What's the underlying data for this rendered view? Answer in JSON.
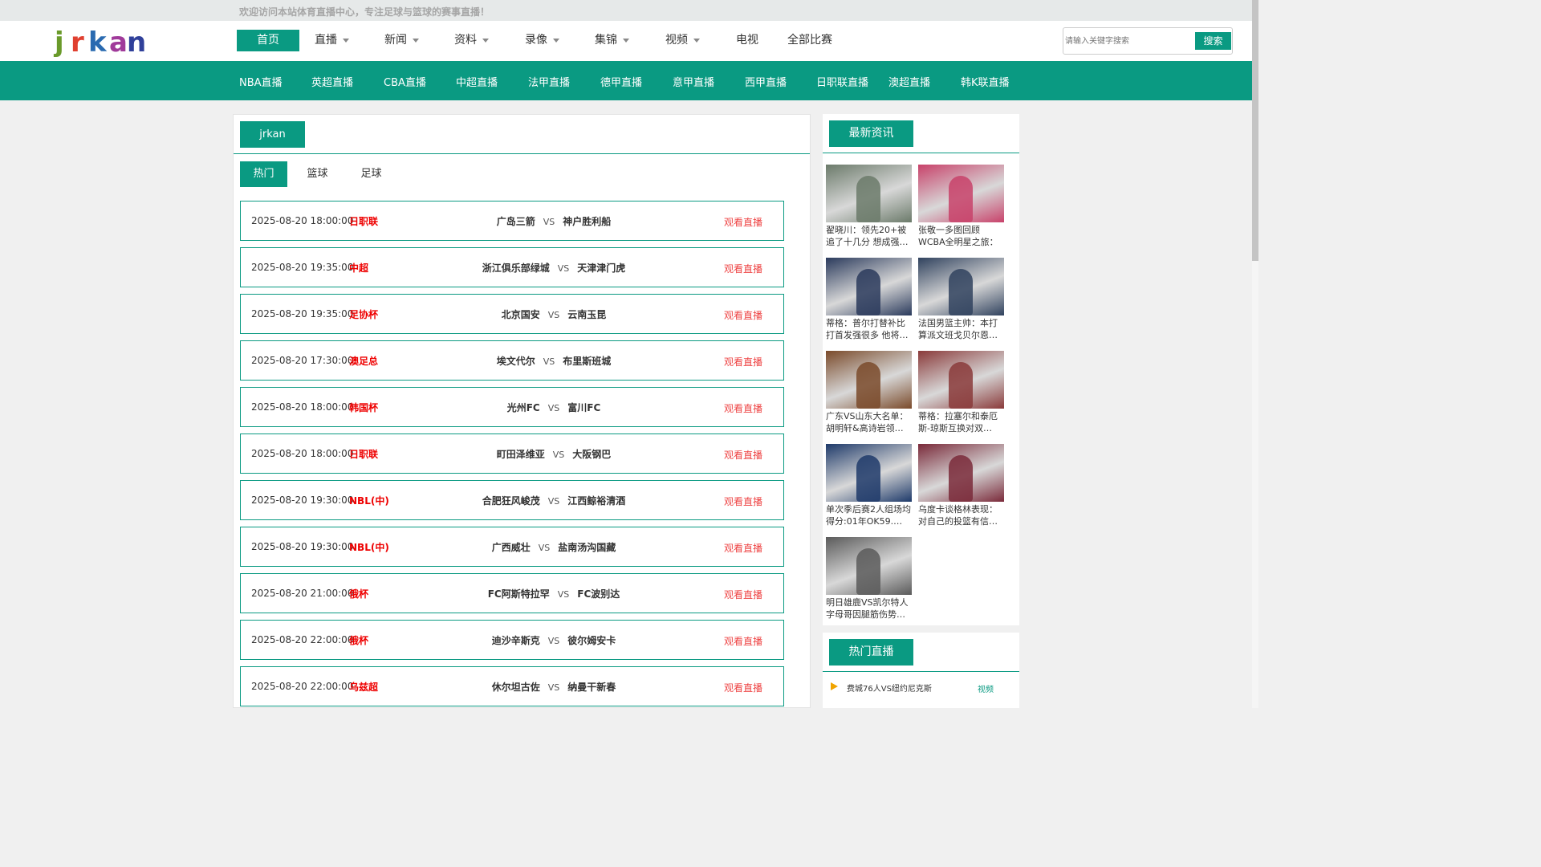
{
  "topbar": {
    "message": "欢迎访问本站体育直播中心，专注足球与篮球的赛事直播！"
  },
  "logo": {
    "text": "jrkan"
  },
  "nav": {
    "items": [
      {
        "label": "首页",
        "active": true,
        "dropdown": false
      },
      {
        "label": "直播",
        "active": false,
        "dropdown": true
      },
      {
        "label": "新闻",
        "active": false,
        "dropdown": true
      },
      {
        "label": "资料",
        "active": false,
        "dropdown": true
      },
      {
        "label": "录像",
        "active": false,
        "dropdown": true
      },
      {
        "label": "集锦",
        "active": false,
        "dropdown": true
      },
      {
        "label": "视频",
        "active": false,
        "dropdown": true
      },
      {
        "label": "电视",
        "active": false,
        "dropdown": false
      },
      {
        "label": "全部比赛",
        "active": false,
        "dropdown": false
      }
    ]
  },
  "search": {
    "placeholder": "请输入关键字搜索",
    "button": "搜索"
  },
  "subnav": {
    "items": [
      "NBA直播",
      "英超直播",
      "CBA直播",
      "中超直播",
      "法甲直播",
      "德甲直播",
      "意甲直播",
      "西甲直播",
      "日职联直播",
      "澳超直播",
      "韩K联直播"
    ]
  },
  "main": {
    "title": "jrkan",
    "tabs": [
      {
        "label": "热门",
        "active": true
      },
      {
        "label": "篮球",
        "active": false
      },
      {
        "label": "足球",
        "active": false
      }
    ],
    "watch_label": "观看直播",
    "vs_label": "VS",
    "matches": [
      {
        "time": "2025-08-20 18:00:00",
        "league": "日职联",
        "home": "广岛三箭",
        "away": "神户胜利船"
      },
      {
        "time": "2025-08-20 19:35:00",
        "league": "中超",
        "home": "浙江俱乐部绿城",
        "away": "天津津门虎"
      },
      {
        "time": "2025-08-20 19:35:00",
        "league": "足协杯",
        "home": "北京国安",
        "away": "云南玉昆"
      },
      {
        "time": "2025-08-20 17:30:00",
        "league": "澳足总",
        "home": "埃文代尔",
        "away": "布里斯班城"
      },
      {
        "time": "2025-08-20 18:00:00",
        "league": "韩国杯",
        "home": "光州FC",
        "away": "富川FC"
      },
      {
        "time": "2025-08-20 18:00:00",
        "league": "日职联",
        "home": "町田泽维亚",
        "away": "大阪钢巴"
      },
      {
        "time": "2025-08-20 19:30:00",
        "league": "NBL(中)",
        "home": "合肥狂风峻茂",
        "away": "江西鲸裕清酒"
      },
      {
        "time": "2025-08-20 19:30:00",
        "league": "NBL(中)",
        "home": "广西威壮",
        "away": "盐南汤沟国藏"
      },
      {
        "time": "2025-08-20 21:00:00",
        "league": "俄杯",
        "home": "FC阿斯特拉罕",
        "away": "FC波别达"
      },
      {
        "time": "2025-08-20 22:00:00",
        "league": "俄杯",
        "home": "迪沙辛斯克",
        "away": "彼尔姆安卡"
      },
      {
        "time": "2025-08-20 22:00:00",
        "league": "乌兹超",
        "home": "休尔坦古佐",
        "away": "纳曼干新春"
      }
    ]
  },
  "sidebar": {
    "news_title": "最新资讯",
    "news": [
      {
        "caption": "翟晓川：领先20+被追了十几分 想成强…",
        "bg": "#6b7a6a"
      },
      {
        "caption": "张敬一多图回顾WCBA全明星之旅：分…",
        "bg": "#c8426a"
      },
      {
        "caption": "蒂格：普尔打替补比打首发强很多 他将…",
        "bg": "#2a3a5c"
      },
      {
        "caption": "法国男篮主帅：本打算派文班戈贝尔恩…",
        "bg": "#30425e"
      },
      {
        "caption": "广东VS山东大名单：胡明轩&高诗岩领…",
        "bg": "#7a4a2a"
      },
      {
        "caption": "蒂格：拉塞尔和泰厄斯-琼斯互换对双…",
        "bg": "#8a3a3a"
      },
      {
        "caption": "单次季后赛2人组场均得分:01年OK59.…",
        "bg": "#1e3a6a"
      },
      {
        "caption": "乌度卡谈格林表现：对自己的投篮有信…",
        "bg": "#7a2a3a"
      },
      {
        "caption": "明日雄鹿VS凯尔特人 字母哥因腿筋伤势…",
        "bg": "#5a5a5a"
      }
    ],
    "hot_title": "热门直播",
    "hot": [
      {
        "name": "费城76人VS纽约尼克斯",
        "tag": "视频"
      }
    ]
  },
  "colors": {
    "accent": "#0a9a82",
    "league": "#e00000",
    "watch": "#e44444"
  }
}
